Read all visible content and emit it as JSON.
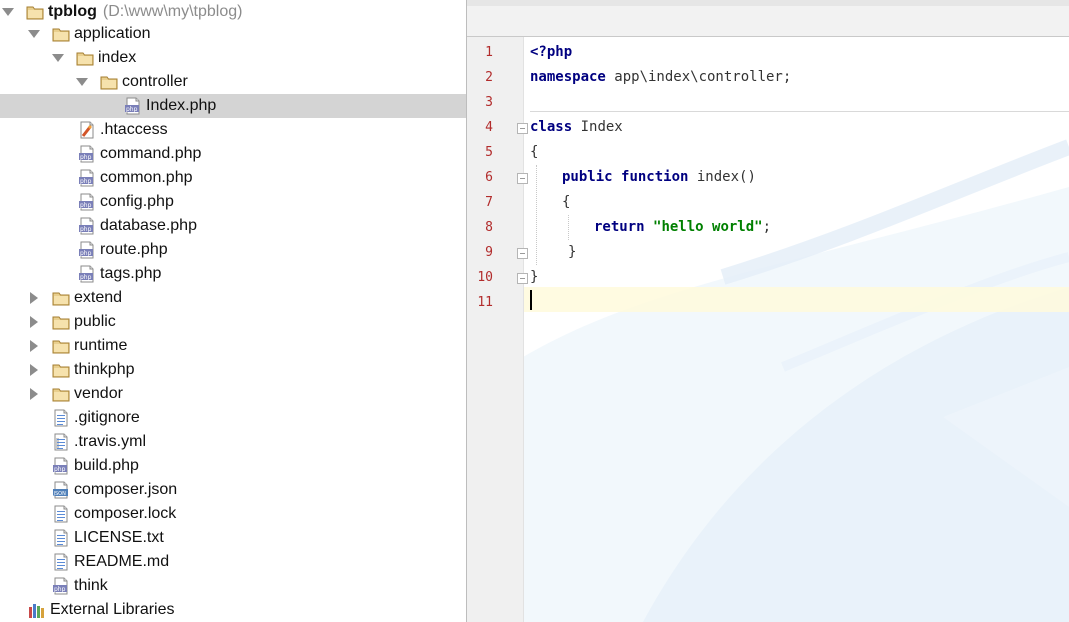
{
  "project_tree": {
    "root": {
      "name": "tpblog",
      "path": "(D:\\www\\my\\tpblog)"
    },
    "items": [
      {
        "label": "application",
        "icon": "folder-icon"
      },
      {
        "label": "index",
        "icon": "folder-icon"
      },
      {
        "label": "controller",
        "icon": "folder-icon"
      },
      {
        "label": "Index.php",
        "icon": "php-file-icon",
        "selected": true
      },
      {
        "label": ".htaccess",
        "icon": "htaccess-file-icon"
      },
      {
        "label": "command.php",
        "icon": "php-file-icon"
      },
      {
        "label": "common.php",
        "icon": "php-file-icon"
      },
      {
        "label": "config.php",
        "icon": "php-file-icon"
      },
      {
        "label": "database.php",
        "icon": "php-file-icon"
      },
      {
        "label": "route.php",
        "icon": "php-file-icon"
      },
      {
        "label": "tags.php",
        "icon": "php-file-icon"
      },
      {
        "label": "extend",
        "icon": "folder-icon"
      },
      {
        "label": "public",
        "icon": "folder-icon"
      },
      {
        "label": "runtime",
        "icon": "folder-icon"
      },
      {
        "label": "thinkphp",
        "icon": "folder-icon"
      },
      {
        "label": "vendor",
        "icon": "folder-icon"
      },
      {
        "label": ".gitignore",
        "icon": "text-file-icon"
      },
      {
        "label": ".travis.yml",
        "icon": "yml-file-icon"
      },
      {
        "label": "build.php",
        "icon": "php-file-icon"
      },
      {
        "label": "composer.json",
        "icon": "json-file-icon"
      },
      {
        "label": "composer.lock",
        "icon": "text-file-icon"
      },
      {
        "label": "LICENSE.txt",
        "icon": "text-file-icon"
      },
      {
        "label": "README.md",
        "icon": "text-file-icon"
      },
      {
        "label": "think",
        "icon": "php-file-icon"
      }
    ],
    "external_libraries": "External Libraries",
    "php_badge": "php",
    "json_badge": "JSON"
  },
  "editor": {
    "line_numbers": [
      "1",
      "2",
      "3",
      "4",
      "5",
      "6",
      "7",
      "8",
      "9",
      "10",
      "11"
    ],
    "code": {
      "l1_kw": "<?php",
      "l2_kw": "namespace",
      "l2_rest": " app\\index\\controller;",
      "l4_kw": "class",
      "l4_rest": " Index",
      "l5": "{",
      "l6_kw1": "public",
      "l6_kw2": "function",
      "l6_rest": " index()",
      "l7": "{",
      "l8_kw": "return",
      "l8_str": "\"hello world\"",
      "l8_end": ";",
      "l9": "}",
      "l10": "}"
    }
  },
  "colors": {
    "folder": "#d6b36b",
    "keyword": "#000080",
    "string": "#008000",
    "line_number": "#b22c2c",
    "selected_row": "#d4d4d4",
    "caret_line": "#fffadc"
  }
}
